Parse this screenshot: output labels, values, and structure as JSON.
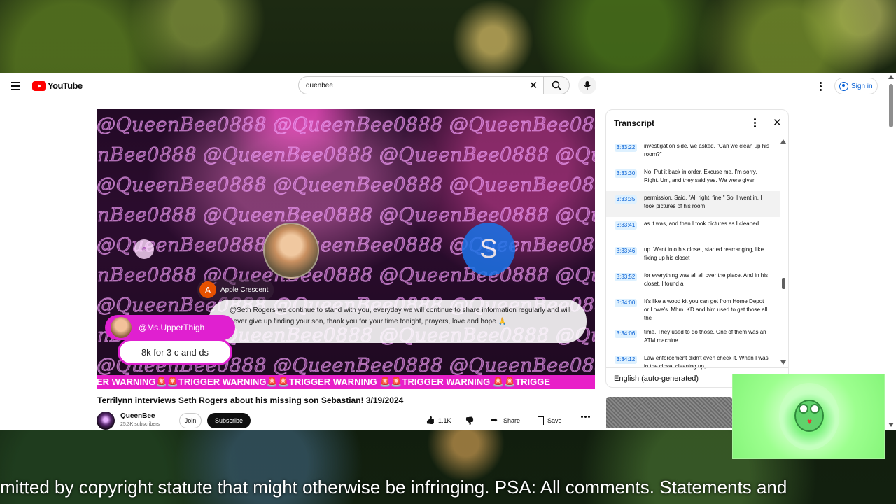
{
  "header": {
    "logo_text": "YouTube",
    "search_value": "quenbee",
    "signin_label": "Sign in"
  },
  "video": {
    "watermark": "@QueenBee0888 @QueenBee0888 @QueenBee0888 @QueenBee0888",
    "s_avatar_letter": "S",
    "small_avatar_letter": "e",
    "commenter_avatar_letter": "A",
    "commenter_name": "Apple Crescent",
    "comment_text": "@Seth Rogers we continue to stand with you, everyday we will continue to share information regularly and will never give up finding your son, thank you for your time tonight, prayers, love and hope 🙏",
    "pill_name": "@Ms.UpperThigh",
    "pill_subtitle": "8k for 3 c and ds",
    "ticker": "ER WARNING🚨🚨TRIGGER WARNING🚨🚨TRIGGER WARNING 🚨🚨TRIGGER WARNING 🚨🚨TRIGGE",
    "progress": 0.56,
    "title": "Terrilynn interviews Seth Rogers about his missing son Sebastian! 3/19/2024"
  },
  "channel": {
    "name": "QueenBee",
    "subscribers": "25.3K subscribers",
    "join_label": "Join",
    "subscribe_label": "Subscribe",
    "like_count": "1.1K",
    "share_label": "Share",
    "save_label": "Save"
  },
  "transcript": {
    "title": "Transcript",
    "language": "English (auto-generated)",
    "segments": [
      {
        "time": "3:33:22",
        "text": "investigation side, we asked, \"Can we clean up his room?\""
      },
      {
        "time": "3:33:30",
        "text": "No. Put it back in order. Excuse me. I'm sorry. Right. Um, and they said yes. We were given"
      },
      {
        "time": "3:33:35",
        "text": "permission. Said, \"All right, fine.\" So, I went in, I took pictures of his room"
      },
      {
        "time": "3:33:41",
        "text": "as it was, and then I took pictures as I cleaned"
      },
      {
        "time": "3:33:46",
        "text": "up. Went into his closet, started rearranging, like fixing up his closet"
      },
      {
        "time": "3:33:52",
        "text": "for everything was all all over the place. And in his closet, I found a"
      },
      {
        "time": "3:34:00",
        "text": "It's like a wood kit you can get from Home Depot or Lowe's. Mhm. KD and him used to get those all the"
      },
      {
        "time": "3:34:06",
        "text": "time. They used to do those. One of them was an ATM machine."
      },
      {
        "time": "3:34:12",
        "text": "Law enforcement didn't even check it. When I was in the closet cleaning up, I"
      }
    ]
  },
  "overlay": {
    "froggy_label": "Froggy",
    "crawl_text": "mitted by copyright statute that might otherwise be infringing.  PSA: All comments. Statements and"
  }
}
